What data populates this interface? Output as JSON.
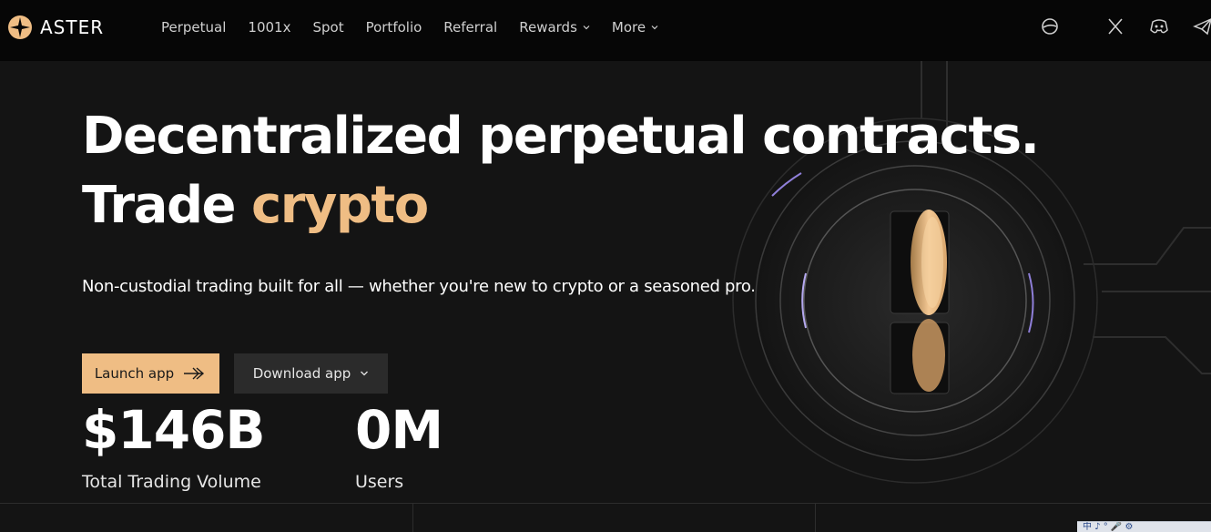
{
  "brand": {
    "name": "ASTER",
    "accent_color": "#efbd84"
  },
  "nav": {
    "items": [
      {
        "label": "Perpetual",
        "dropdown": false
      },
      {
        "label": "1001x",
        "dropdown": false
      },
      {
        "label": "Spot",
        "dropdown": false
      },
      {
        "label": "Portfolio",
        "dropdown": false
      },
      {
        "label": "Referral",
        "dropdown": false
      },
      {
        "label": "Rewards",
        "dropdown": true
      },
      {
        "label": "More",
        "dropdown": true
      }
    ],
    "social_icons": [
      "globe-icon",
      "x-icon",
      "discord-icon",
      "telegram-icon"
    ]
  },
  "hero": {
    "title_line1": "Decentralized perpetual contracts.",
    "title_line2_prefix": "Trade",
    "title_line2_accent": "crypto",
    "subtitle": "Non-custodial trading built for all — whether you're new to crypto or a seasoned pro.",
    "launch_label": "Launch app",
    "download_label": "Download app"
  },
  "stats": [
    {
      "value": "$146B",
      "label": "Total Trading Volume"
    },
    {
      "value": "0M",
      "label": "Users"
    }
  ],
  "system_tray": {
    "text": "中 ♪ ° 🎤 ⚙"
  }
}
